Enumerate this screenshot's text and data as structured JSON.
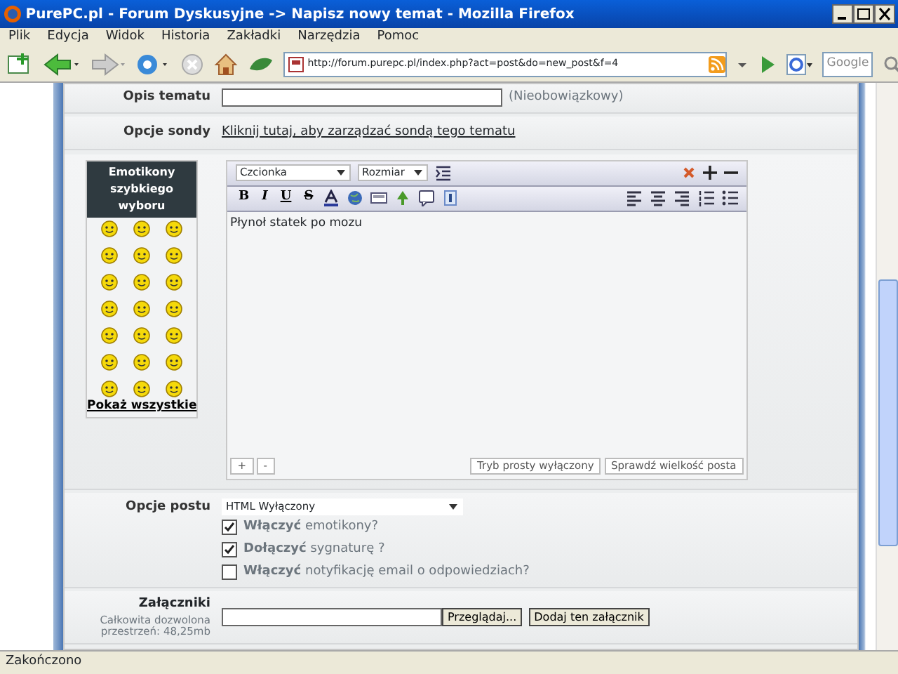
{
  "window": {
    "title": "PurePC.pl - Forum Dyskusyjne -> Napisz nowy temat - Mozilla Firefox"
  },
  "menu": [
    "Plik",
    "Edycja",
    "Widok",
    "Historia",
    "Zakładki",
    "Narzędzia",
    "Pomoc"
  ],
  "toolbar": {
    "address": "http://forum.purepc.pl/index.php?act=post&do=new_post&f=4",
    "search_placeholder": "Google"
  },
  "topic_description": {
    "label": "Opis tematu",
    "note": "(Nieobowiązkowy)"
  },
  "poll": {
    "label": "Opcje sondy",
    "link": "Kliknij tutaj, aby zarządzać sondą tego tematu"
  },
  "emoticons": {
    "title": "Emotikony szybkiego wyboru",
    "show_all": "Pokaż wszystkie"
  },
  "editor": {
    "font": "Czcionka",
    "size": "Rozmiar",
    "format_buttons": [
      "B",
      "I",
      "U",
      "S"
    ],
    "text": "Płynoł statek po mozu",
    "resize_buttons": [
      "+",
      "-"
    ],
    "mode_button": "Tryb prosty wyłączony",
    "check_button": "Sprawdź wielkość posta"
  },
  "post_options": {
    "label": "Opcje postu",
    "select": "HTML Wyłączony",
    "checkboxes": [
      {
        "text": "**Włączyć** emotikony?",
        "checked": true
      },
      {
        "text": "**Dołączyć** sygnaturę ?",
        "checked": true
      },
      {
        "text": "**Włączyć** notyfikację email o odpowiedziach?",
        "checked": false
      }
    ]
  },
  "attachments": {
    "label": "Załączniki",
    "note": "Całkowita dozwolona przestrzeń: 48,25mb",
    "browse": "Przeglądaj...",
    "add": "Dodaj ten załącznik"
  },
  "status_bar": "Zakończono"
}
